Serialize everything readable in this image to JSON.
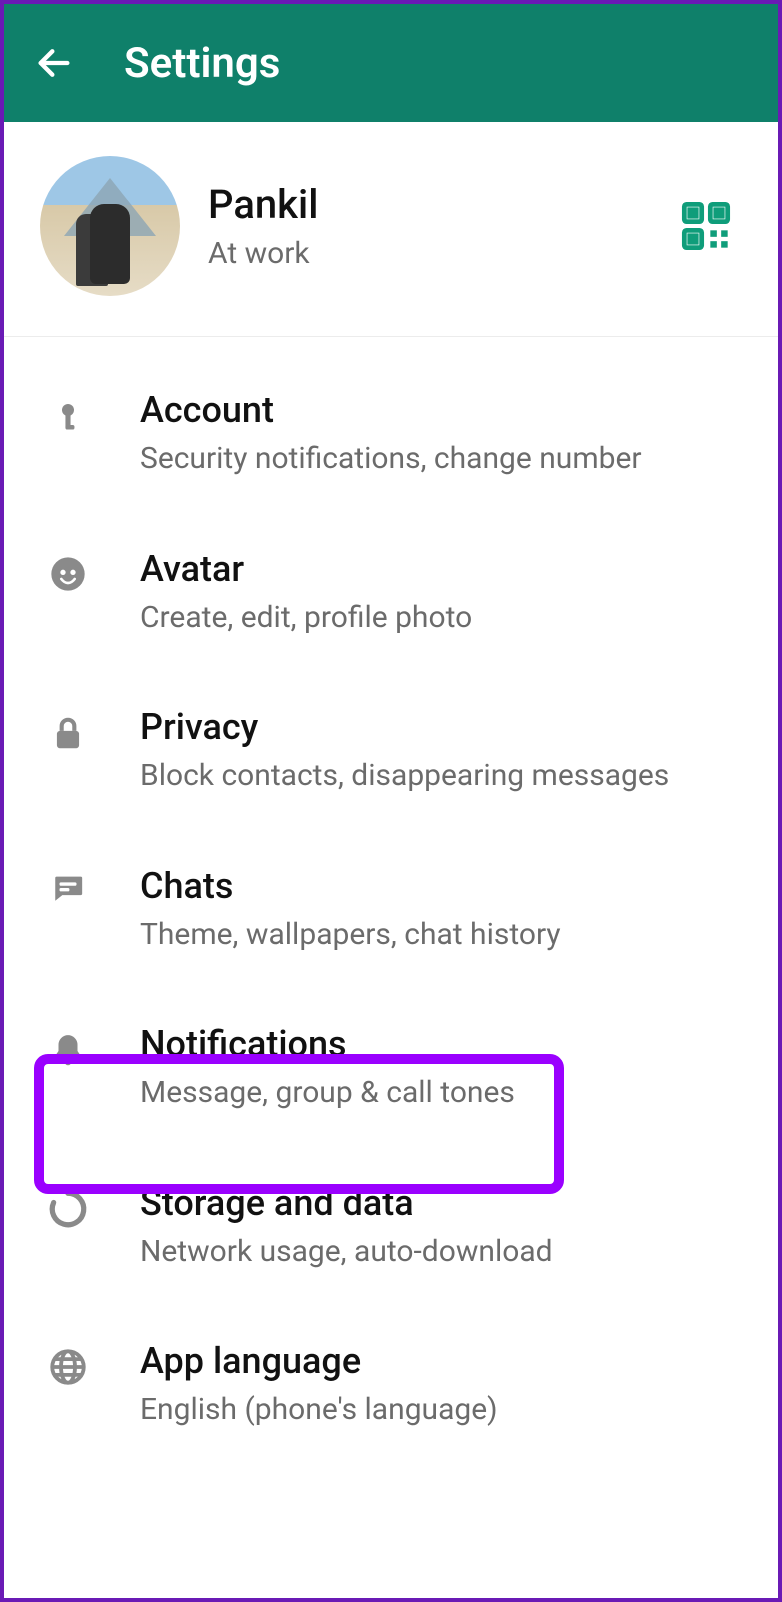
{
  "header": {
    "title": "Settings"
  },
  "profile": {
    "name": "Pankil",
    "status": "At work"
  },
  "items": [
    {
      "title": "Account",
      "subtitle": "Security notifications, change number"
    },
    {
      "title": "Avatar",
      "subtitle": "Create, edit, profile photo"
    },
    {
      "title": "Privacy",
      "subtitle": "Block contacts, disappearing messages"
    },
    {
      "title": "Chats",
      "subtitle": "Theme, wallpapers, chat history"
    },
    {
      "title": "Notifications",
      "subtitle": "Message, group & call tones"
    },
    {
      "title": "Storage and data",
      "subtitle": "Network usage, auto-download"
    },
    {
      "title": "App language",
      "subtitle": "English (phone's language)"
    }
  ],
  "colors": {
    "accent": "#0f806a",
    "highlight": "#9a00ff",
    "qr": "#0f9d7a"
  }
}
